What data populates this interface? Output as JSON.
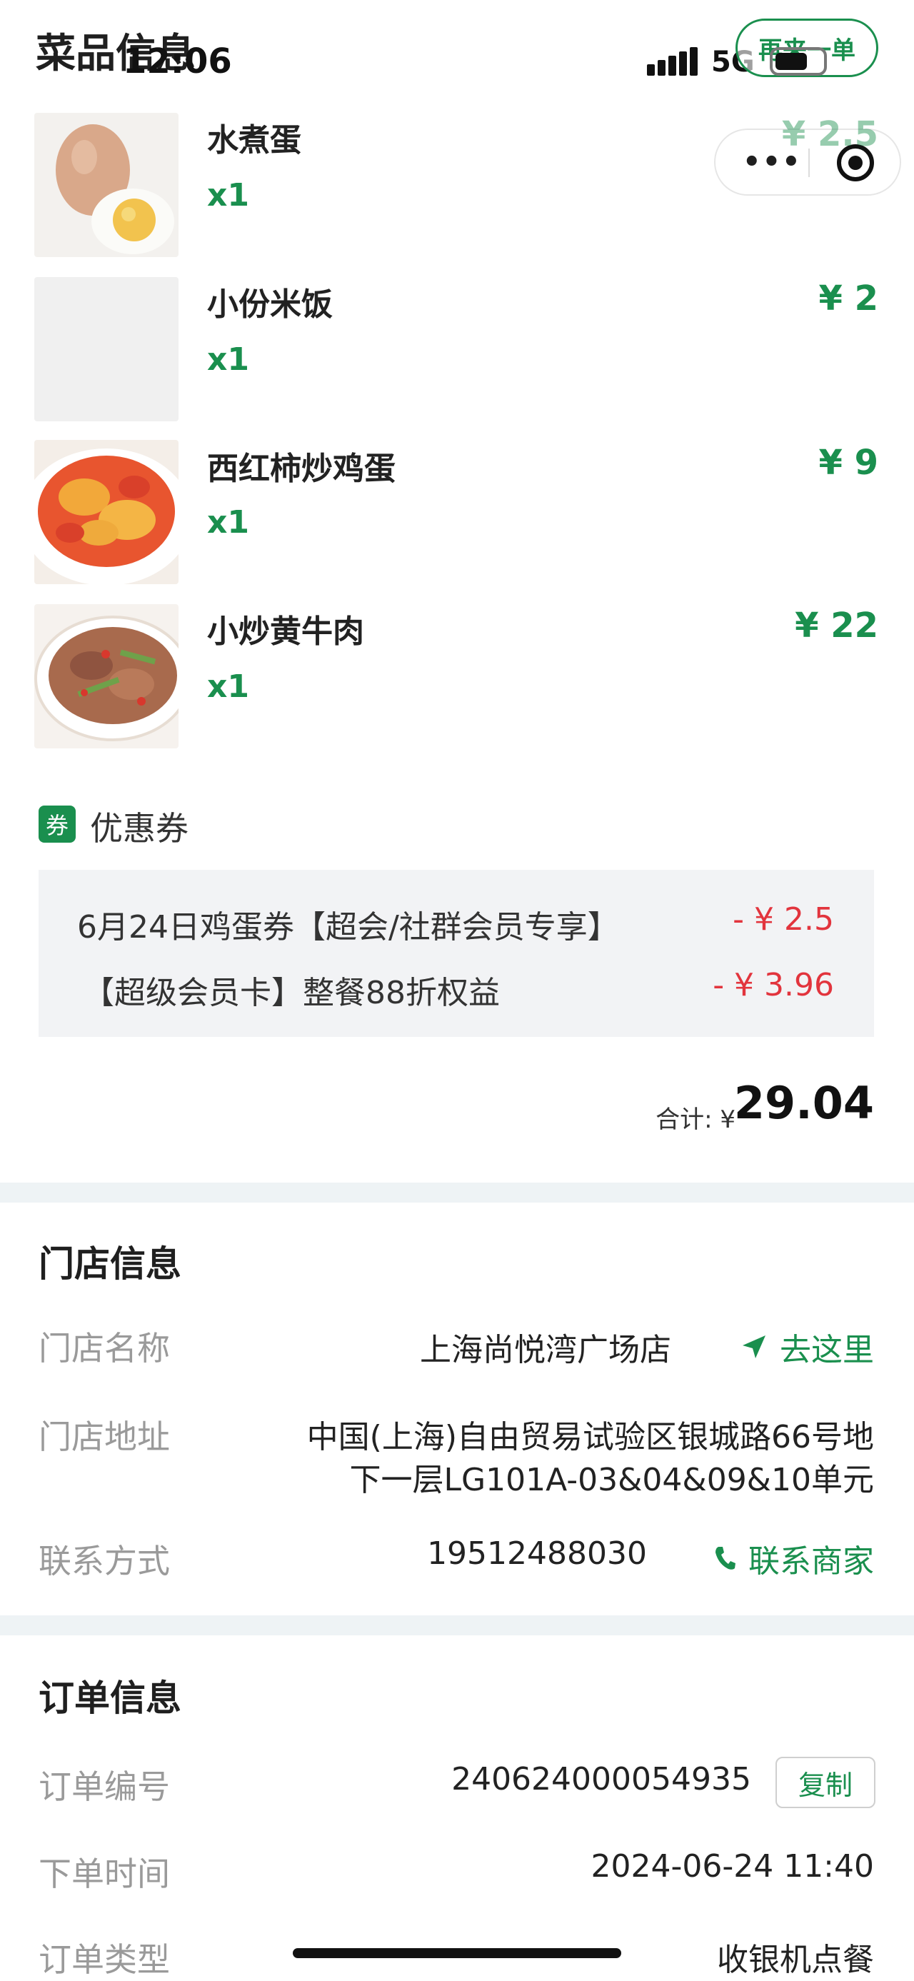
{
  "header": {
    "section_title": "菜品信息",
    "time": "12:06",
    "network": "5G",
    "reorder_label": "再来一单"
  },
  "dishes": [
    {
      "name": "水煮蛋",
      "qty": "x1",
      "price": "¥ 2.5",
      "image": "boiled-egg"
    },
    {
      "name": "小份米饭",
      "qty": "x1",
      "price": "¥ 2",
      "image": "rice-placeholder"
    },
    {
      "name": "西红柿炒鸡蛋",
      "qty": "x1",
      "price": "¥ 9",
      "image": "tomato-egg"
    },
    {
      "name": "小炒黄牛肉",
      "qty": "x1",
      "price": "¥ 22",
      "image": "stir-fried-beef"
    }
  ],
  "coupons": {
    "badge": "券",
    "title": "优惠券",
    "items": [
      {
        "name": "6月24日鸡蛋券【超会/社群会员专享】",
        "amount": "- ¥ 2.5"
      },
      {
        "name": "【超级会员卡】整餐88折权益",
        "amount": "- ¥ 3.96"
      }
    ]
  },
  "total": {
    "label": "合计: ¥",
    "value": "29.04"
  },
  "store": {
    "title": "门店信息",
    "name_label": "门店名称",
    "name": "上海尚悦湾广场店",
    "navigate": "去这里",
    "address_label": "门店地址",
    "address_line1": "中国(上海)自由贸易试验区银城路66号地",
    "address_line2": "下一层LG101A-03&04&09&10单元",
    "contact_label": "联系方式",
    "phone": "19512488030",
    "contact_action": "联系商家"
  },
  "order": {
    "title": "订单信息",
    "number_label": "订单编号",
    "number": "240624000054935",
    "copy": "复制",
    "time_label": "下单时间",
    "time": "2024-06-24 11:40",
    "type_label": "订单类型",
    "type": "收银机点餐"
  },
  "colors": {
    "accent": "#1a8f4e",
    "discount": "#e2343d",
    "muted": "#9a9a9a"
  }
}
